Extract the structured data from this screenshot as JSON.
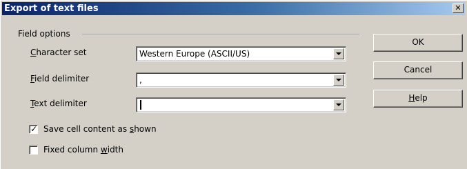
{
  "window": {
    "title": "Export of text files",
    "close_symbol": "✕"
  },
  "field_options": {
    "group_label": "Field options",
    "character_set": {
      "label_accel": "C",
      "label_rest": "haracter set",
      "value": "Western Europe (ASCII/US)"
    },
    "field_delimiter": {
      "label_accel": "F",
      "label_rest": "ield delimiter",
      "value": ","
    },
    "text_delimiter": {
      "label_accel": "T",
      "label_rest": "ext delimiter",
      "value": ""
    },
    "save_cell_content": {
      "label_pre": "Save cell content as ",
      "label_accel": "s",
      "label_post": "hown",
      "checked": true,
      "check_glyph": "✓"
    },
    "fixed_column_width": {
      "label_pre": "Fixed column ",
      "label_accel": "w",
      "label_post": "idth",
      "checked": false
    }
  },
  "buttons": {
    "ok": "OK",
    "cancel": "Cancel",
    "help_accel": "H",
    "help_rest": "elp"
  }
}
